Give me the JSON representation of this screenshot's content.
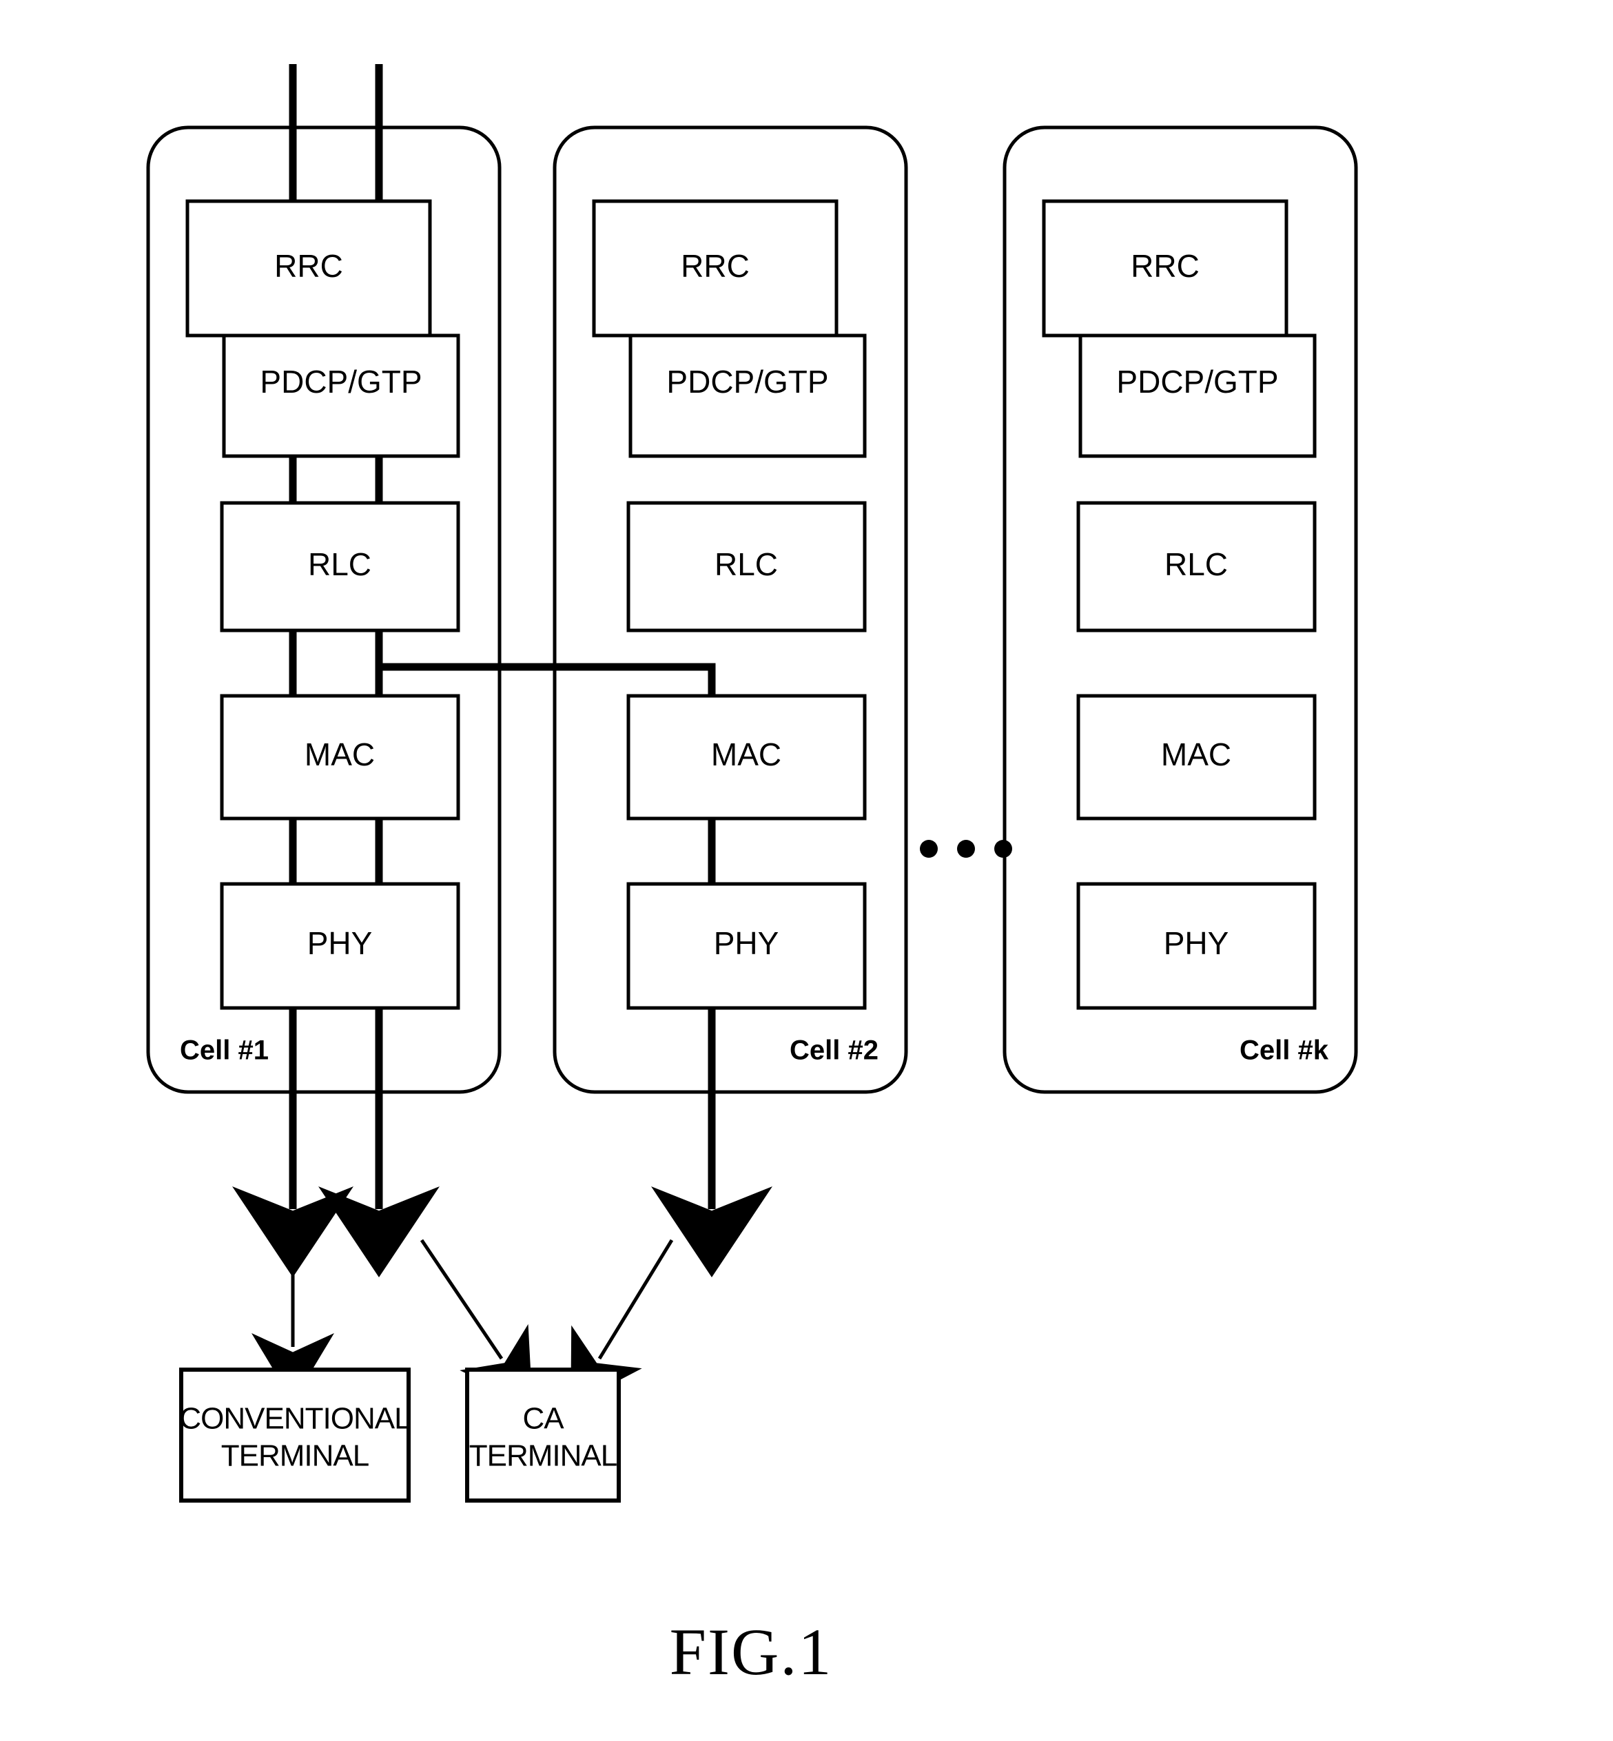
{
  "figure": {
    "caption": "FIG.1",
    "ellipsis": "• • •"
  },
  "cells": [
    {
      "label": "Cell #1",
      "layers": [
        {
          "name": "RRC",
          "label": "RRC"
        },
        {
          "name": "PDCP/GTP",
          "label": "PDCP/GTP"
        },
        {
          "name": "RLC",
          "label": "RLC"
        },
        {
          "name": "MAC",
          "label": "MAC"
        },
        {
          "name": "PHY",
          "label": "PHY"
        }
      ]
    },
    {
      "label": "Cell #2",
      "layers": [
        {
          "name": "RRC",
          "label": "RRC"
        },
        {
          "name": "PDCP/GTP",
          "label": "PDCP/GTP"
        },
        {
          "name": "RLC",
          "label": "RLC"
        },
        {
          "name": "MAC",
          "label": "MAC"
        },
        {
          "name": "PHY",
          "label": "PHY"
        }
      ]
    },
    {
      "label": "Cell #k",
      "layers": [
        {
          "name": "RRC",
          "label": "RRC"
        },
        {
          "name": "PDCP/GTP",
          "label": "PDCP/GTP"
        },
        {
          "name": "RLC",
          "label": "RLC"
        },
        {
          "name": "MAC",
          "label": "MAC"
        },
        {
          "name": "PHY",
          "label": "PHY"
        }
      ]
    }
  ],
  "terminals": [
    {
      "name": "conventional-terminal",
      "line1": "CONVENTIONAL",
      "line2": "TERMINAL"
    },
    {
      "name": "ca-terminal",
      "line1": "CA",
      "line2": "TERMINAL"
    }
  ],
  "colors": {
    "stroke": "#000000",
    "background": "#ffffff"
  }
}
